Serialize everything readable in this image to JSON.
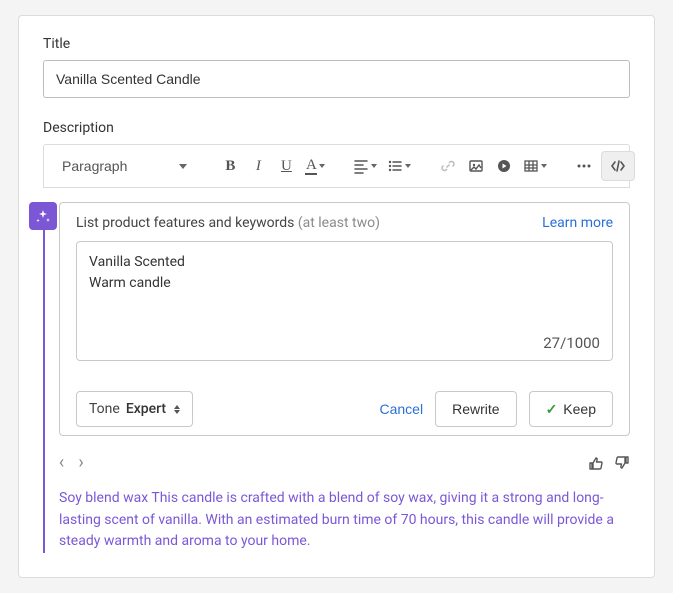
{
  "title": {
    "label": "Title",
    "value": "Vanilla Scented Candle"
  },
  "description": {
    "label": "Description",
    "paragraph_dropdown": "Paragraph"
  },
  "features": {
    "title": "List product features and keywords",
    "hint": "(at least two)",
    "learn_more": "Learn more",
    "text": "Vanilla Scented\nWarm candle",
    "count": "27/1000"
  },
  "tone": {
    "label": "Tone",
    "value": "Expert"
  },
  "actions": {
    "cancel": "Cancel",
    "rewrite": "Rewrite",
    "keep": "Keep"
  },
  "generated": {
    "text": "Soy blend wax This candle is crafted with a blend of soy wax, giving it a strong and long-lasting scent of vanilla. With an estimated burn time of 70 hours, this candle will provide a steady warmth and aroma to your home."
  }
}
